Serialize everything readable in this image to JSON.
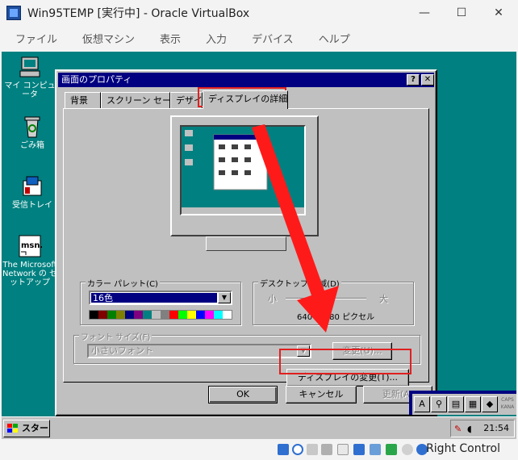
{
  "host": {
    "window_title": "Win95TEMP [実行中] - Oracle VirtualBox",
    "menu": [
      "ファイル",
      "仮想マシン",
      "表示",
      "入力",
      "デバイス",
      "ヘルプ"
    ],
    "controls": {
      "minimize": "—",
      "maximize": "☐",
      "close": "✕"
    },
    "host_key": "Right Control"
  },
  "desktop": {
    "icons": [
      {
        "label": "マイ コンピュータ"
      },
      {
        "label": "ごみ箱"
      },
      {
        "label": "受信トレイ"
      },
      {
        "label": "The Microsoft Network の セットアップ"
      }
    ]
  },
  "dialog": {
    "title": "画面のプロパティ",
    "help_btn": "?",
    "close_btn": "✕",
    "tabs": [
      "背景",
      "スクリーン セーバー",
      "デザイン",
      "ディスプレイの詳細"
    ],
    "active_tab": 3,
    "color_palette": {
      "label": "カラー パレット(C)",
      "value": "16色"
    },
    "desktop_area": {
      "label": "デスクトップ 領域(D)",
      "min": "小",
      "max": "大",
      "value": "640 × 480 ピクセル"
    },
    "font_size": {
      "label": "フォント サイズ(F)",
      "value": "小さいフォント",
      "change": "変更(U)..."
    },
    "change_display": "ディスプレイの変更(T)...",
    "ok": "OK",
    "cancel": "キャンセル",
    "apply": "更新(A)"
  },
  "taskbar": {
    "start": "スタート",
    "clock": "21:54"
  },
  "ime": {
    "keys": [
      "A",
      "",
      "",
      "",
      ""
    ],
    "caps": "CAPS KANA"
  },
  "colors": {
    "desktop": "#008080",
    "titlebar": "#000080",
    "highlight": "#e02020"
  }
}
